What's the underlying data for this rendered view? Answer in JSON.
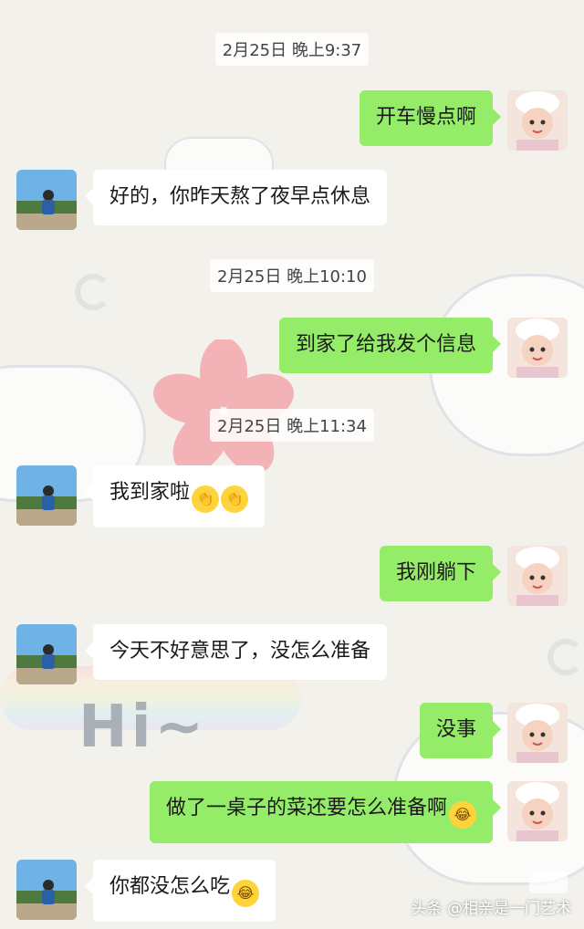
{
  "timestamps": [
    "2月25日 晚上9:37",
    "2月25日 晚上10:10",
    "2月25日 晚上11:34"
  ],
  "messages": [
    {
      "side": "out",
      "text": "开车慢点啊"
    },
    {
      "side": "in",
      "text": "好的，你昨天熬了夜早点休息"
    },
    {
      "side": "out",
      "text": "到家了给我发个信息"
    },
    {
      "side": "in",
      "text": "我到家啦"
    },
    {
      "side": "out",
      "text": "我刚躺下"
    },
    {
      "side": "in",
      "text": "今天不好意思了，没怎么准备"
    },
    {
      "side": "out",
      "text": "没事"
    },
    {
      "side": "out",
      "text": "做了一桌子的菜还要怎么准备啊"
    },
    {
      "side": "in",
      "text": "你都没怎么吃"
    }
  ],
  "background_text": "Hi~",
  "watermark": "头条 @相亲是一门艺术",
  "colors": {
    "outgoing_bubble": "#95ec69",
    "incoming_bubble": "#ffffff",
    "chat_background": "#f3f1ec"
  }
}
